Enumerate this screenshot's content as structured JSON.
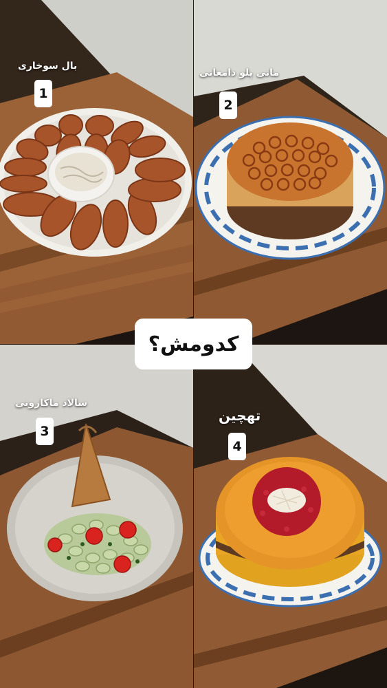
{
  "title": "کدومش؟",
  "dishes": [
    {
      "number": "1",
      "name": "بال سوخاری"
    },
    {
      "number": "2",
      "name": "مانی پلو دامغانی"
    },
    {
      "number": "3",
      "name": "سالاد ماکارونی"
    },
    {
      "number": "4",
      "name": "تهچین"
    }
  ]
}
